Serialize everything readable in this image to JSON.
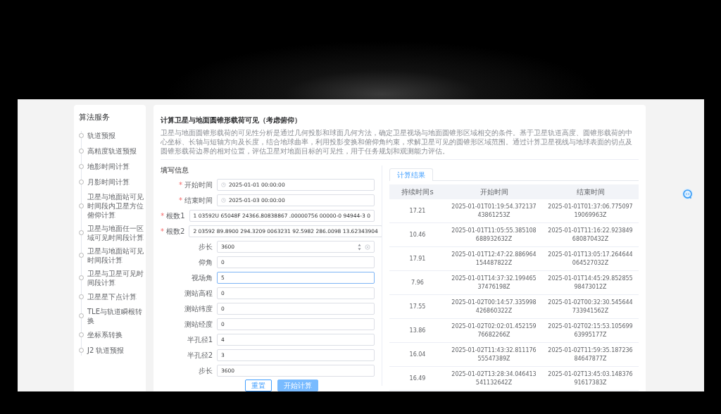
{
  "sidebar": {
    "title": "算法服务",
    "items": [
      {
        "label": "轨道预报",
        "selected": false
      },
      {
        "label": "高精度轨道预报",
        "selected": false
      },
      {
        "label": "地影时间计算",
        "selected": false
      },
      {
        "label": "月影时间计算",
        "selected": false
      },
      {
        "label": "卫星与地面站可见时间段内卫星方位俯仰计算",
        "selected": false
      },
      {
        "label": "卫星与地面任一区域可见时间段计算",
        "selected": false
      },
      {
        "label": "卫星与地面站可见时间段计算",
        "selected": false
      },
      {
        "label": "卫星与卫星可见时间段计算",
        "selected": false
      },
      {
        "label": "卫星星下点计算",
        "selected": false
      },
      {
        "label": "TLE与轨道瞬根转换",
        "selected": false
      },
      {
        "label": "坐标系转换",
        "selected": false
      },
      {
        "label": "J2 轨道预报",
        "selected": false
      }
    ]
  },
  "page": {
    "title": "计算卫星与地面圆锥形载荷可见（考虑俯仰）",
    "description": "卫星与地面圆锥形载荷的可见性分析是通过几何投影和球面几何方法，确定卫星视场与地面圆锥形区域相交的条件。基于卫星轨道高度、圆锥形载荷的中心坐标、长轴与短轴方向及长度，结合地球曲率，利用投影变换和俯仰角约束，求解卫星可见的圆锥形区域范围。通过计算卫星视线与地球表面的切点及圆锥形载荷边界的相对位置，评估卫星对地面目标的可见性，用于任务规划和观测能力评估。"
  },
  "form": {
    "title": "填写信息",
    "required_mark": "*",
    "fields": [
      {
        "label": "开始时间",
        "value": "2025-01-01 00:00:00",
        "kind": "datetime",
        "required": true,
        "focused": false
      },
      {
        "label": "结束时间",
        "value": "2025-01-03 00:00:00",
        "kind": "datetime",
        "required": true,
        "focused": false
      },
      {
        "label": "根数1",
        "value": "1 03592U 65048F   24366.80838867  .00000756  00000-0  94944-3 0",
        "kind": "text",
        "required": true,
        "focused": false
      },
      {
        "label": "根数2",
        "value": "2 03592  89.8900 294.3209 0063231  92.5982 286.0098 13.62343904",
        "kind": "text",
        "required": true,
        "focused": false
      },
      {
        "label": "步长",
        "value": "3600",
        "kind": "number",
        "required": false,
        "focused": false
      },
      {
        "label": "仰角",
        "value": "0",
        "kind": "text",
        "required": false,
        "focused": false
      },
      {
        "label": "视场角",
        "value": "5",
        "kind": "text",
        "required": false,
        "focused": true
      },
      {
        "label": "测站高程",
        "value": "0",
        "kind": "text",
        "required": false,
        "focused": false
      },
      {
        "label": "测站纬度",
        "value": "0",
        "kind": "text",
        "required": false,
        "focused": false
      },
      {
        "label": "测站经度",
        "value": "0",
        "kind": "text",
        "required": false,
        "focused": false
      },
      {
        "label": "半孔径1",
        "value": "4",
        "kind": "text",
        "required": false,
        "focused": false
      },
      {
        "label": "半孔径2",
        "value": "3",
        "kind": "text",
        "required": false,
        "focused": false
      },
      {
        "label": "步长",
        "value": "3600",
        "kind": "text",
        "required": false,
        "focused": false
      }
    ],
    "buttons": [
      {
        "label": "重置",
        "kind": "secondary"
      },
      {
        "label": "开始计算",
        "kind": "primary"
      }
    ]
  },
  "results": {
    "tabs": [
      {
        "label": "计算结果",
        "selected": true
      }
    ],
    "table": {
      "columns": [
        "持续时间s",
        "开始时间",
        "结束时间"
      ],
      "rows": [
        [
          "17.21",
          "2025-01-01T01:19:54.372137 43861253Z",
          "2025-01-01T01:37:06.775097 19069963Z"
        ],
        [
          "10.46",
          "2025-01-01T11:05:55.385108 688932632Z",
          "2025-01-01T11:16:22.923849 680870432Z"
        ],
        [
          "17.91",
          "2025-01-01T12:47:22.886964 154487822Z",
          "2025-01-01T13:05:17.264644 064527032Z"
        ],
        [
          "7.96",
          "2025-01-01T14:37:32.199465 37476198Z",
          "2025-01-01T14:45:29.852855 98473012Z"
        ],
        [
          "17.55",
          "2025-01-02T00:14:57.335998 426860322Z",
          "2025-01-02T00:32:30.545644 733941562Z"
        ],
        [
          "13.86",
          "2025-01-02T02:02:01.452159 76682266Z",
          "2025-01-02T02:15:53.105699 63995177Z"
        ],
        [
          "16.04",
          "2025-01-02T11:43:32.811176 55547389Z",
          "2025-01-02T11:59:35.187236 84647877Z"
        ],
        [
          "16.49",
          "2025-01-02T13:28:34.046413 541132642Z",
          "2025-01-02T13:45:03.148376 91617383Z"
        ]
      ]
    }
  }
}
